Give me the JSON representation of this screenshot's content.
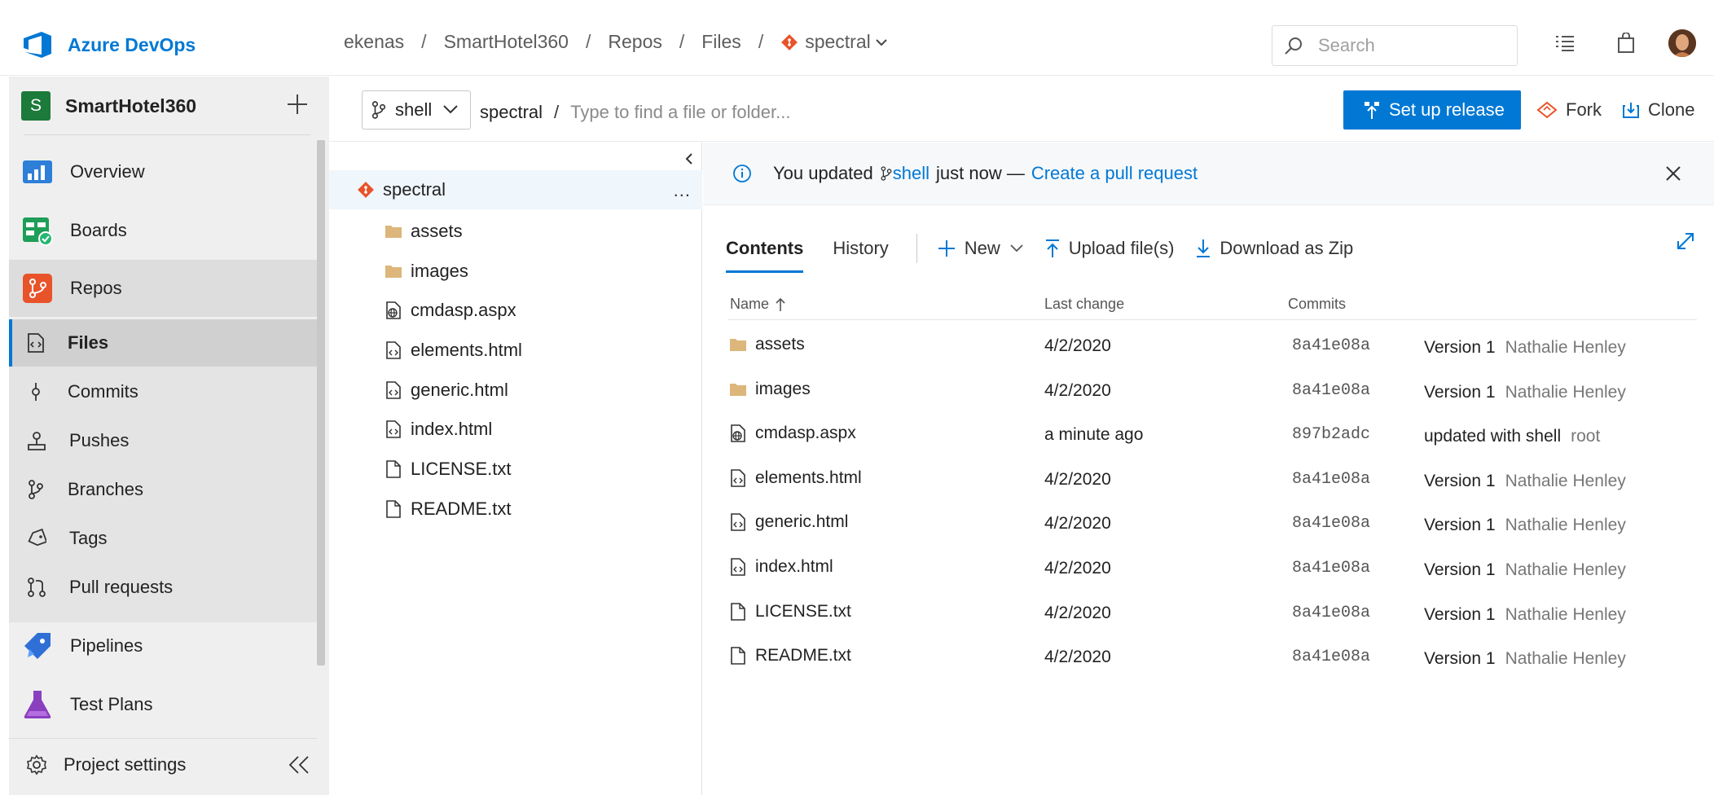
{
  "brand": {
    "name": "Azure DevOps"
  },
  "breadcrumb": {
    "org": "ekenas",
    "project": "SmartHotel360",
    "section": "Repos",
    "page": "Files",
    "repo": "spectral"
  },
  "search": {
    "placeholder": "Search"
  },
  "topbar_icons": [
    "checklist-icon",
    "shopping-bag-icon",
    "avatar"
  ],
  "sidebar": {
    "project_initial": "S",
    "project_name": "SmartHotel360",
    "items": [
      {
        "label": "Overview",
        "icon": "overview-icon"
      },
      {
        "label": "Boards",
        "icon": "boards-icon"
      },
      {
        "label": "Repos",
        "icon": "repos-icon"
      },
      {
        "label": "Files",
        "icon": "files-icon"
      },
      {
        "label": "Commits",
        "icon": "commits-icon"
      },
      {
        "label": "Pushes",
        "icon": "pushes-icon"
      },
      {
        "label": "Branches",
        "icon": "branches-icon"
      },
      {
        "label": "Tags",
        "icon": "tags-icon"
      },
      {
        "label": "Pull requests",
        "icon": "pull-requests-icon"
      },
      {
        "label": "Pipelines",
        "icon": "pipelines-icon"
      },
      {
        "label": "Test Plans",
        "icon": "test-plans-icon"
      }
    ],
    "settings_label": "Project settings"
  },
  "toolbar": {
    "branch": "shell",
    "path_root": "spectral",
    "path_sep": "/",
    "path_placeholder": "Type to find a file or folder...",
    "setup_release": "Set up release",
    "fork": "Fork",
    "clone": "Clone"
  },
  "tree": {
    "root": "spectral",
    "more": "...",
    "items": [
      "assets",
      "images",
      "cmdasp.aspx",
      "elements.html",
      "generic.html",
      "index.html",
      "LICENSE.txt",
      "README.txt"
    ]
  },
  "banner": {
    "prefix": "You updated",
    "branch": "shell",
    "middle": "just now —",
    "link": "Create a pull request"
  },
  "tabs": {
    "contents": "Contents",
    "history": "History"
  },
  "commands": {
    "new": "New",
    "upload": "Upload file(s)",
    "download": "Download as Zip"
  },
  "table": {
    "headers": {
      "name": "Name",
      "last_change": "Last change",
      "commits": "Commits"
    },
    "rows": [
      {
        "name": "assets",
        "type": "folder",
        "last_change": "4/2/2020",
        "commit": "8a41e08a",
        "message": "Version 1",
        "author": "Nathalie Henley"
      },
      {
        "name": "images",
        "type": "folder",
        "last_change": "4/2/2020",
        "commit": "8a41e08a",
        "message": "Version 1",
        "author": "Nathalie Henley"
      },
      {
        "name": "cmdasp.aspx",
        "type": "web",
        "last_change": "a minute ago",
        "commit": "897b2adc",
        "message": "updated with shell",
        "author": "root"
      },
      {
        "name": "elements.html",
        "type": "code",
        "last_change": "4/2/2020",
        "commit": "8a41e08a",
        "message": "Version 1",
        "author": "Nathalie Henley"
      },
      {
        "name": "generic.html",
        "type": "code",
        "last_change": "4/2/2020",
        "commit": "8a41e08a",
        "message": "Version 1",
        "author": "Nathalie Henley"
      },
      {
        "name": "index.html",
        "type": "code",
        "last_change": "4/2/2020",
        "commit": "8a41e08a",
        "message": "Version 1",
        "author": "Nathalie Henley"
      },
      {
        "name": "LICENSE.txt",
        "type": "file",
        "last_change": "4/2/2020",
        "commit": "8a41e08a",
        "message": "Version 1",
        "author": "Nathalie Henley"
      },
      {
        "name": "README.txt",
        "type": "file",
        "last_change": "4/2/2020",
        "commit": "8a41e08a",
        "message": "Version 1",
        "author": "Nathalie Henley"
      }
    ]
  },
  "colors": {
    "accent": "#0078d4",
    "folder": "#dcb67a",
    "repo": "#e8532a"
  }
}
